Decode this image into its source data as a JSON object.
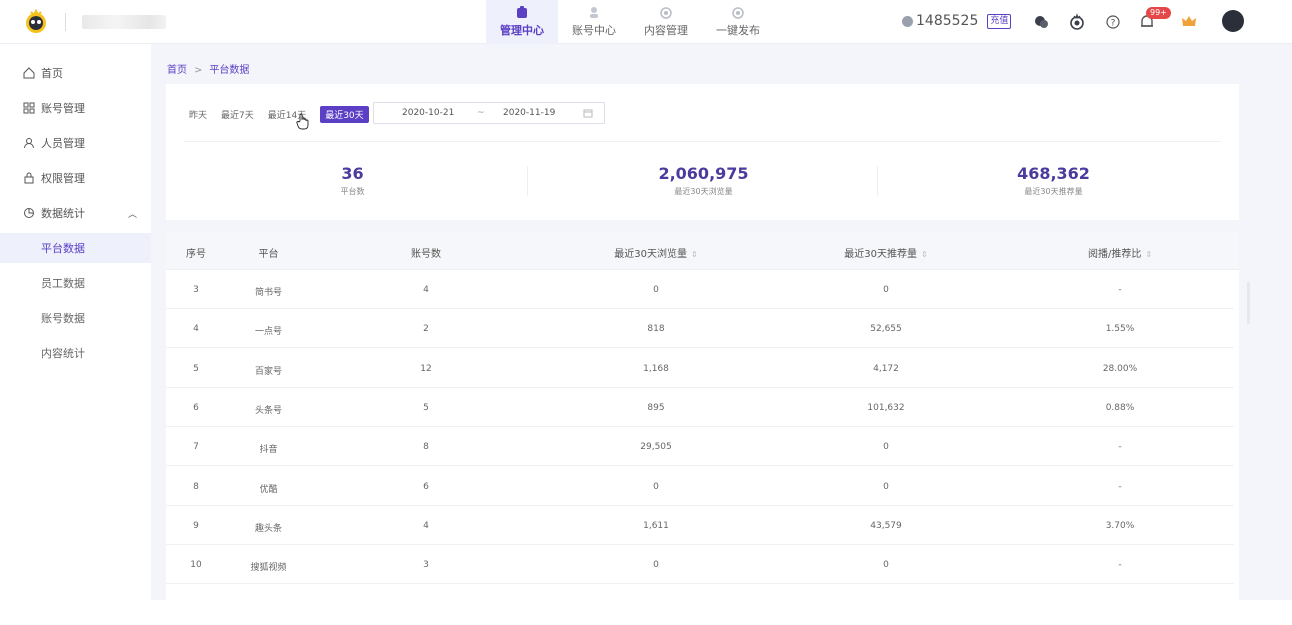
{
  "header": {
    "nav": [
      {
        "label": "管理中心",
        "active": true,
        "icon": "briefcase-icon"
      },
      {
        "label": "账号中心",
        "active": false,
        "icon": "user-icon"
      },
      {
        "label": "内容管理",
        "active": false,
        "icon": "robot-icon"
      },
      {
        "label": "一键发布",
        "active": false,
        "icon": "robot-icon"
      }
    ],
    "balance": "1485525",
    "recharge_label": "充值",
    "notifications_badge": "99+"
  },
  "sidebar": {
    "items": [
      {
        "label": "首页",
        "icon": "home-icon"
      },
      {
        "label": "账号管理",
        "icon": "grid-icon"
      },
      {
        "label": "人员管理",
        "icon": "person-icon"
      },
      {
        "label": "权限管理",
        "icon": "lock-icon"
      },
      {
        "label": "数据统计",
        "icon": "stats-icon",
        "expanded": true
      }
    ],
    "sub_items": [
      {
        "label": "平台数据",
        "active": true
      },
      {
        "label": "员工数据",
        "active": false
      },
      {
        "label": "账号数据",
        "active": false
      },
      {
        "label": "内容统计",
        "active": false
      }
    ]
  },
  "breadcrumb": {
    "home": "首页",
    "sep": ">",
    "current": "平台数据"
  },
  "filters": {
    "ranges": [
      "昨天",
      "最近7天",
      "最近14天",
      "最近30天"
    ],
    "active_range": "最近30天",
    "date_start": "2020-10-21",
    "date_sep": "~",
    "date_end": "2020-11-19"
  },
  "stats": [
    {
      "value": "36",
      "label": "平台数"
    },
    {
      "value": "2,060,975",
      "label": "最近30天浏览量"
    },
    {
      "value": "468,362",
      "label": "最近30天推荐量"
    }
  ],
  "table": {
    "columns": [
      "序号",
      "平台",
      "账号数",
      "最近30天浏览量",
      "最近30天推荐量",
      "阅播/推荐比"
    ],
    "sort_glyph": "⇕",
    "rows": [
      [
        "3",
        "简书号",
        "4",
        "0",
        "0",
        "-"
      ],
      [
        "4",
        "一点号",
        "2",
        "818",
        "52,655",
        "1.55%"
      ],
      [
        "5",
        "百家号",
        "12",
        "1,168",
        "4,172",
        "28.00%"
      ],
      [
        "6",
        "头条号",
        "5",
        "895",
        "101,632",
        "0.88%"
      ],
      [
        "7",
        "抖音",
        "8",
        "29,505",
        "0",
        "-"
      ],
      [
        "8",
        "优酷",
        "6",
        "0",
        "0",
        "-"
      ],
      [
        "9",
        "趣头条",
        "4",
        "1,611",
        "43,579",
        "3.70%"
      ],
      [
        "10",
        "搜狐视频",
        "3",
        "0",
        "0",
        "-"
      ]
    ]
  },
  "colors": {
    "accent": "#5b3fc4",
    "stat_number": "#4c3a9e",
    "background": "#f3f5fa"
  }
}
